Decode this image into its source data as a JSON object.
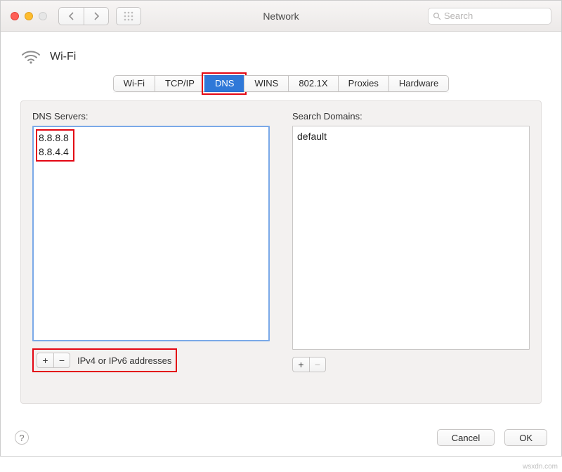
{
  "window": {
    "title": "Network"
  },
  "search": {
    "placeholder": "Search"
  },
  "header": {
    "interface": "Wi-Fi"
  },
  "tabs": [
    "Wi-Fi",
    "TCP/IP",
    "DNS",
    "WINS",
    "802.1X",
    "Proxies",
    "Hardware"
  ],
  "active_tab": "DNS",
  "dns": {
    "label": "DNS Servers:",
    "entries": [
      "8.8.8.8",
      "8.8.4.4"
    ],
    "hint": "IPv4 or IPv6 addresses"
  },
  "search_domains": {
    "label": "Search Domains:",
    "entries": [
      "default"
    ]
  },
  "icons": {
    "plus": "+",
    "minus": "−"
  },
  "footer": {
    "cancel": "Cancel",
    "ok": "OK"
  },
  "source": "wsxdn.com"
}
